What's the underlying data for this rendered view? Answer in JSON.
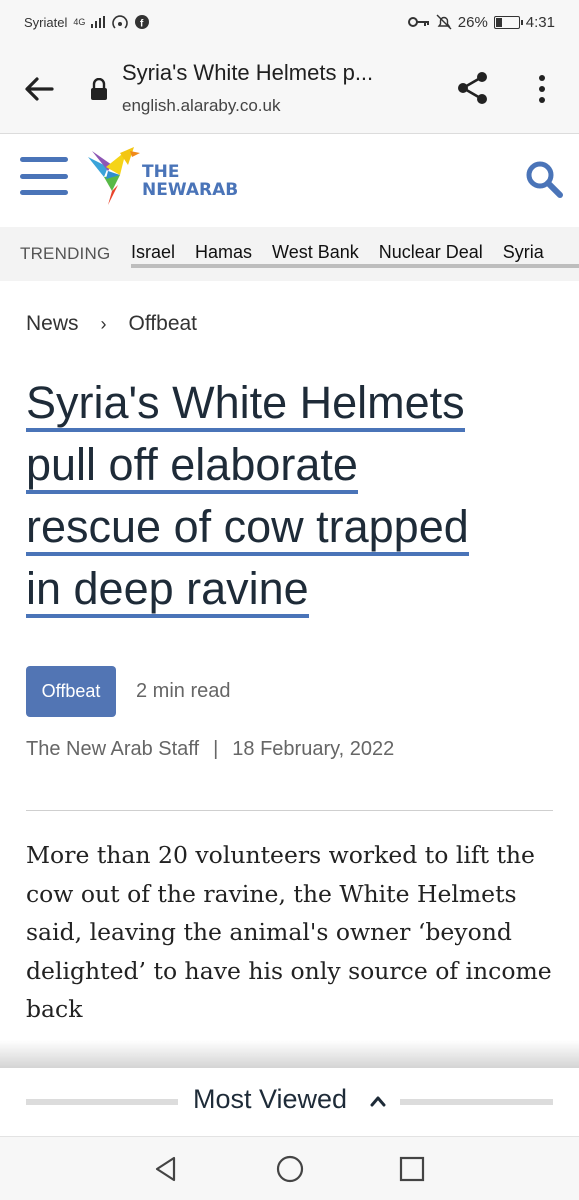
{
  "status_bar": {
    "carrier": "Syriatel",
    "network": "4G",
    "battery_percent": "26%",
    "battery_level": 0.26,
    "time": "4:31"
  },
  "browser": {
    "page_title": "Syria's White Helmets p...",
    "url_host": "english.alaraby.co.uk",
    "icons": [
      "back-arrow-icon",
      "lock-icon",
      "share-icon",
      "more-vert-icon"
    ]
  },
  "site": {
    "logo_line1": "THE",
    "logo_line2": "NEWARAB",
    "accent_color": "#4a74b8",
    "icons": [
      "hamburger-icon",
      "hummingbird-logo",
      "search-icon"
    ]
  },
  "trending": {
    "label": "TRENDING",
    "items": [
      "Israel",
      "Hamas",
      "West Bank",
      "Nuclear Deal",
      "Syria"
    ]
  },
  "breadcrumb": {
    "items": [
      "News",
      "Offbeat"
    ],
    "separator": "›"
  },
  "article": {
    "headline_lines": [
      "Syria's White Helmets",
      "pull off elaborate",
      "rescue of cow trapped",
      "in deep ravine"
    ],
    "tag": "Offbeat",
    "tag_color": "#5275b4",
    "read_time": "2 min read",
    "author": "The New Arab Staff",
    "separator": "|",
    "date": "18 February, 2022",
    "lede": "More than 20 volunteers worked to lift the cow out of the ravine, the White Helmets said, leaving the animal's owner ‘beyond delighted’ to have his only source of income back"
  },
  "most_viewed": {
    "label": "Most Viewed"
  },
  "nav_bar": {
    "icons": [
      "nav-back-icon",
      "nav-home-icon",
      "nav-recents-icon"
    ]
  }
}
